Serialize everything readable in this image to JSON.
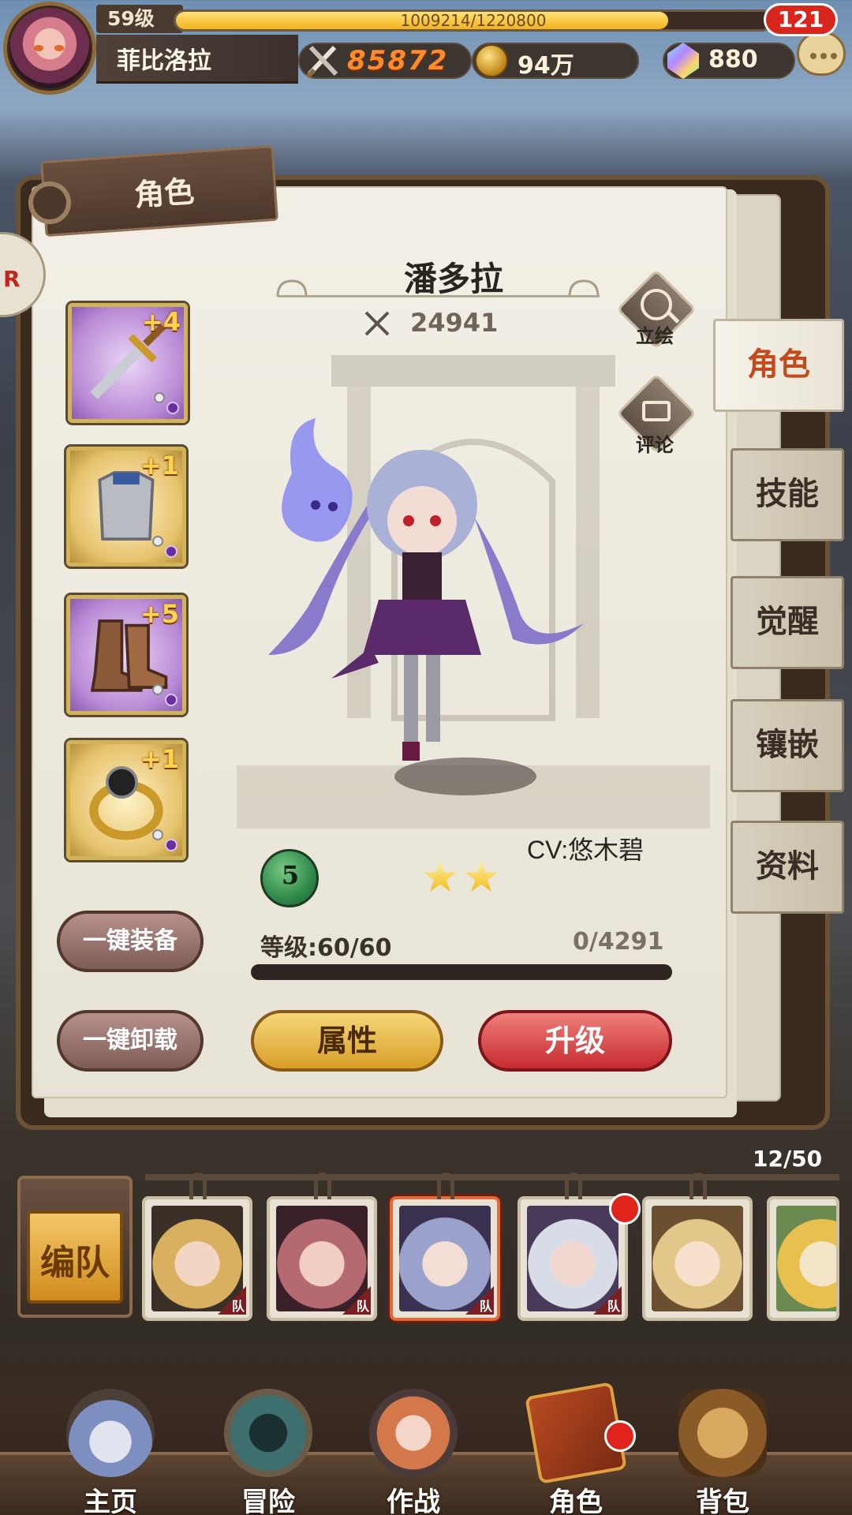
{
  "player": {
    "level": "59级",
    "exp": "1009214/1220800",
    "exp_fraction": 0.827,
    "name": "菲比洛拉",
    "power": "85872",
    "gold": "94万",
    "gems": "880",
    "chat_unread": "121"
  },
  "panel": {
    "title": "角色"
  },
  "hero": {
    "name": "潘多拉",
    "power": "24941",
    "cv": "CV:悠木碧",
    "rank": "5",
    "stars": 2,
    "level": "等级:60/60",
    "exp": "0/4291",
    "exp_fraction": 0
  },
  "hero_actions": {
    "portrait": "立绘",
    "comment": "评论"
  },
  "equipment": [
    {
      "slot": "weapon",
      "plus": "+4",
      "rarity": "purple"
    },
    {
      "slot": "armor",
      "plus": "+1",
      "rarity": "gold"
    },
    {
      "slot": "boots",
      "plus": "+5",
      "rarity": "purple"
    },
    {
      "slot": "ring",
      "plus": "+1",
      "rarity": "gold"
    }
  ],
  "buttons": {
    "equip_all": "一键装备",
    "unequip_all": "一键卸载",
    "attributes": "属性",
    "upgrade": "升级"
  },
  "side_tabs": [
    {
      "label": "角色",
      "active": true
    },
    {
      "label": "技能",
      "active": false
    },
    {
      "label": "觉醒",
      "active": false
    },
    {
      "label": "镶嵌",
      "active": false
    },
    {
      "label": "资料",
      "active": false
    }
  ],
  "roster": {
    "count": "12/50",
    "team_button": "编队",
    "team_flag": "队",
    "cards": [
      {
        "in_team": true,
        "selected": false,
        "alert": false
      },
      {
        "in_team": true,
        "selected": false,
        "alert": false
      },
      {
        "in_team": true,
        "selected": true,
        "alert": false
      },
      {
        "in_team": true,
        "selected": false,
        "alert": true
      },
      {
        "in_team": false,
        "selected": false,
        "alert": false
      },
      {
        "in_team": false,
        "selected": false,
        "alert": false
      }
    ]
  },
  "bottom_nav": [
    {
      "label": "主页",
      "alert": false
    },
    {
      "label": "冒险",
      "alert": false
    },
    {
      "label": "作战",
      "alert": false
    },
    {
      "label": "角色",
      "alert": true
    },
    {
      "label": "背包",
      "alert": false
    }
  ],
  "colors": {
    "accent_red": "#d8261d",
    "active_tab_text": "#c34a1c",
    "power_orange": "#ff8a2a",
    "exp_yellow": "#f2b21a"
  },
  "icons": {
    "power": "crossed-swords-icon",
    "gold": "coin-icon",
    "gems": "crystal-icon",
    "chat": "chat-bubble-icon",
    "portrait": "magnifier-icon",
    "comment": "speech-bubble-icon"
  }
}
